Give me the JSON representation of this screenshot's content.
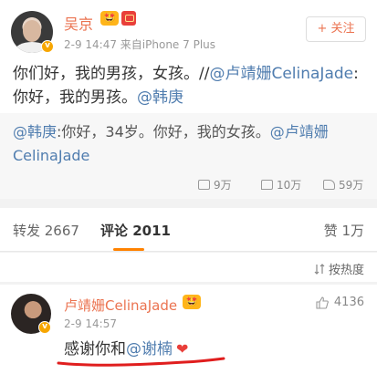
{
  "post": {
    "username": "吴京",
    "crown_badge": "🤩",
    "verified_mark": "v",
    "meta": "2-9 14:47  来自iPhone 7 Plus",
    "follow_label": "+ 关注",
    "text_plain_1": "你们好，我的男孩，女孩。//",
    "text_mention_1": "@卢靖姗CelinaJade",
    "text_plain_2": ":你好，我的男孩。",
    "text_mention_2": "@韩庚"
  },
  "repost": {
    "mention": "@韩庚",
    "text": ":你好，34岁。你好，我的女孩。",
    "mention_2": "@卢靖姗CelinaJade",
    "stats": [
      {
        "icon": "share-icon",
        "value": "9万"
      },
      {
        "icon": "comment-icon",
        "value": "10万"
      },
      {
        "icon": "like-icon",
        "value": "59万"
      }
    ]
  },
  "tabs": {
    "repost_label": "转发 2667",
    "comment_label": "评论 2011",
    "like_label": "赞 1万",
    "accent": "#ff8200"
  },
  "sort": {
    "label": "按热度"
  },
  "comment": {
    "username": "卢靖姗CelinaJade",
    "crown_badge": "🤩",
    "verified_mark": "v",
    "time": "2-9 14:57",
    "likes": "4136",
    "text": "感谢你和",
    "mention": "@谢楠",
    "heart": "❤"
  }
}
